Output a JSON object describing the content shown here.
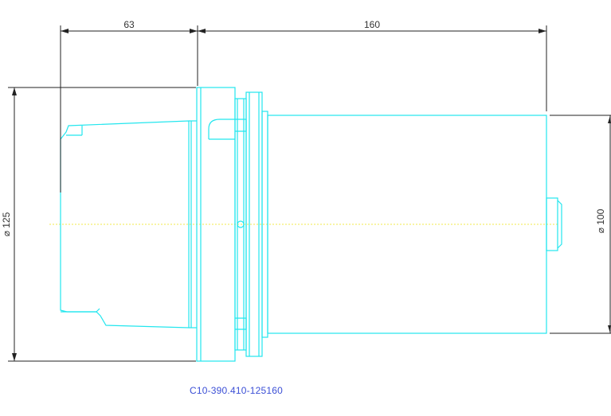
{
  "dimensions": {
    "length_left": "63",
    "length_right": "160",
    "diameter_left": "⌀ 125",
    "diameter_right": "⌀ 100"
  },
  "part_number": "C10-390.410-125160",
  "colors": {
    "outline": "#22e6ee",
    "dimension": "#222222",
    "centerline": "#f0ea4a",
    "caption": "#3b4fd6"
  }
}
